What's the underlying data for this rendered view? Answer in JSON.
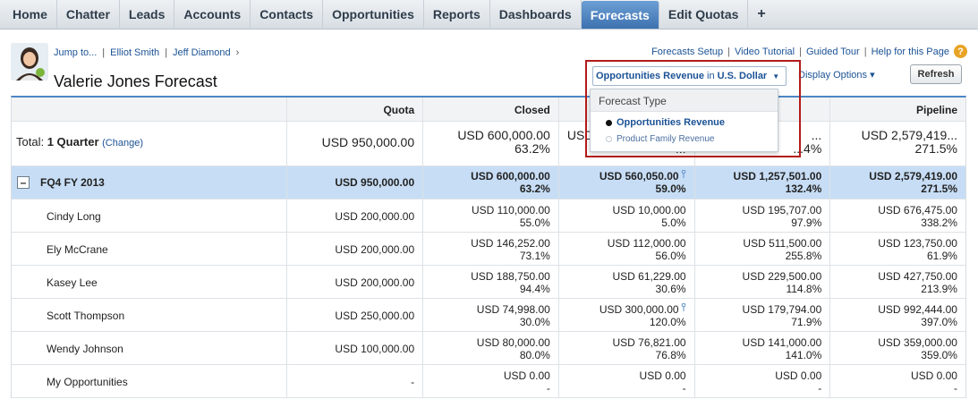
{
  "tabs": [
    {
      "label": "Home",
      "active": false
    },
    {
      "label": "Chatter",
      "active": false
    },
    {
      "label": "Leads",
      "active": false
    },
    {
      "label": "Accounts",
      "active": false
    },
    {
      "label": "Contacts",
      "active": false
    },
    {
      "label": "Opportunities",
      "active": false
    },
    {
      "label": "Reports",
      "active": false
    },
    {
      "label": "Dashboards",
      "active": false
    },
    {
      "label": "Forecasts",
      "active": true
    },
    {
      "label": "Edit Quotas",
      "active": false
    },
    {
      "label": "+",
      "active": false
    }
  ],
  "breadcrumb": {
    "jump": "Jump to...",
    "items": [
      "Elliot Smith",
      "Jeff Diamond"
    ],
    "sep": "|",
    "arrow": "›"
  },
  "page_title": "Valerie Jones Forecast",
  "top_links": [
    "Forecasts Setup",
    "Video Tutorial",
    "Guided Tour",
    "Help for this Page"
  ],
  "help_icon": "?",
  "display_options": "Display Options ▾",
  "refresh_label": "Refresh",
  "dropdown": {
    "selected_type": "Opportunities Revenue",
    "in_label": "in",
    "currency": "U.S. Dollar",
    "header": "Forecast Type",
    "options": [
      {
        "label": "Opportunities Revenue",
        "selected": true
      },
      {
        "label": "Product Family Revenue",
        "selected": false
      }
    ]
  },
  "table": {
    "columns": [
      "",
      "Quota",
      "Closed",
      "",
      "",
      "Pipeline"
    ],
    "total": {
      "label_prefix": "Total:",
      "period": "1 Quarter",
      "change_link": "(Change)",
      "quota": "USD 950,000.00",
      "closed": [
        "USD 600,000.00",
        "63.2%"
      ],
      "col3": [
        "USD",
        "..."
      ],
      "col4": [
        "...",
        "...4%"
      ],
      "pipeline": [
        "USD 2,579,419...",
        "271.5%"
      ]
    },
    "group": {
      "toggle": "–",
      "label": "FQ4 FY 2013",
      "quota": "USD 950,000.00",
      "closed": [
        "USD 600,000.00",
        "63.2%"
      ],
      "commit": [
        "USD 560,050.00",
        "59.0%"
      ],
      "best_case": [
        "USD 1,257,501.00",
        "132.4%"
      ],
      "pipeline": [
        "USD 2,579,419.00",
        "271.5%"
      ]
    },
    "rows": [
      {
        "name": "Cindy Long",
        "quota": "USD 200,000.00",
        "closed": [
          "USD 110,000.00",
          "55.0%"
        ],
        "commit": [
          "USD 10,000.00",
          "5.0%"
        ],
        "best_case": [
          "USD 195,707.00",
          "97.9%"
        ],
        "pipeline": [
          "USD 676,475.00",
          "338.2%"
        ],
        "adjusted": false
      },
      {
        "name": "Ely McCrane",
        "quota": "USD 200,000.00",
        "closed": [
          "USD 146,252.00",
          "73.1%"
        ],
        "commit": [
          "USD 112,000.00",
          "56.0%"
        ],
        "best_case": [
          "USD 511,500.00",
          "255.8%"
        ],
        "pipeline": [
          "USD 123,750.00",
          "61.9%"
        ],
        "adjusted": false
      },
      {
        "name": "Kasey Lee",
        "quota": "USD 200,000.00",
        "closed": [
          "USD 188,750.00",
          "94.4%"
        ],
        "commit": [
          "USD 61,229.00",
          "30.6%"
        ],
        "best_case": [
          "USD 229,500.00",
          "114.8%"
        ],
        "pipeline": [
          "USD 427,750.00",
          "213.9%"
        ],
        "adjusted": false
      },
      {
        "name": "Scott Thompson",
        "quota": "USD 250,000.00",
        "closed": [
          "USD 74,998.00",
          "30.0%"
        ],
        "commit": [
          "USD 300,000.00",
          "120.0%"
        ],
        "best_case": [
          "USD 179,794.00",
          "71.9%"
        ],
        "pipeline": [
          "USD 992,444.00",
          "397.0%"
        ],
        "adjusted": true
      },
      {
        "name": "Wendy Johnson",
        "quota": "USD 100,000.00",
        "closed": [
          "USD 80,000.00",
          "80.0%"
        ],
        "commit": [
          "USD 76,821.00",
          "76.8%"
        ],
        "best_case": [
          "USD 141,000.00",
          "141.0%"
        ],
        "pipeline": [
          "USD 359,000.00",
          "359.0%"
        ],
        "adjusted": false
      },
      {
        "name": "My Opportunities",
        "quota": "-",
        "closed": [
          "USD 0.00",
          "-"
        ],
        "commit": [
          "USD 0.00",
          "-"
        ],
        "best_case": [
          "USD 0.00",
          "-"
        ],
        "pipeline": [
          "USD 0.00",
          "-"
        ],
        "adjusted": false
      }
    ]
  }
}
